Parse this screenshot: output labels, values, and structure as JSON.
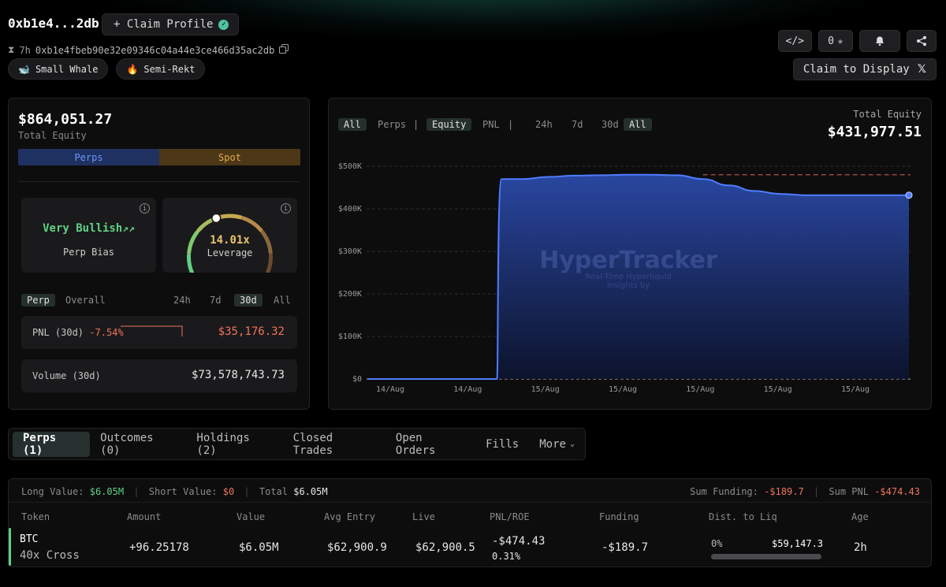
{
  "header": {
    "address_short": "0xb1e4...2db",
    "claim_profile_label": "+ Claim Profile",
    "age": "7h",
    "address_full": "0xb1e4fbeb90e32e09346c04a44e3ce466d35ac2db",
    "tags": [
      {
        "label": "Small Whale",
        "icon": "whale-icon"
      },
      {
        "label": "Semi-Rekt",
        "icon": "fire-icon"
      }
    ],
    "star_count": "0",
    "claim_display_label": "Claim to Display"
  },
  "summary": {
    "total_equity": "$864,051.27",
    "total_equity_label": "Total Equity",
    "perps_label": "Perps",
    "spot_label": "Spot",
    "perps_fraction": 0.5,
    "bias_value": "Very Bullish",
    "bias_label": "Perp Bias",
    "leverage_value": "14.01x",
    "leverage_label": "Leverage",
    "leverage_needle_fraction": 0.42,
    "scope_tabs": [
      "Perp",
      "Overall"
    ],
    "timeframes": [
      "24h",
      "7d",
      "30d",
      "All"
    ],
    "pnl_label": "PNL (30d)",
    "pnl_pct": "-7.54%",
    "pnl_value": "$35,176.32",
    "volume_label": "Volume (30d)",
    "volume_value": "$73,578,743.73"
  },
  "chart_panel": {
    "chips": [
      "All",
      "Perps",
      "|",
      "Equity",
      "PNL",
      "|",
      "24h",
      "7d",
      "30d",
      "All"
    ],
    "total_equity_label": "Total Equity",
    "total_equity_value": "$431,977.51",
    "watermark_title": "HyperTracker",
    "watermark_line1": "Real-Time Hyperliquid",
    "watermark_line2": "Insights by"
  },
  "chart_data": {
    "type": "area",
    "title": "",
    "xlabel": "",
    "ylabel": "",
    "ylim": [
      0,
      500000
    ],
    "y_ticks": [
      "$0",
      "$100K",
      "$200K",
      "$300K",
      "$400K",
      "$500K"
    ],
    "x_ticks": [
      "14/Aug",
      "14/Aug",
      "15/Aug",
      "15/Aug",
      "15/Aug",
      "15/Aug",
      "15/Aug"
    ],
    "series": [
      {
        "values": [
          0,
          0,
          0,
          0,
          0,
          0,
          470000,
          475000,
          478000,
          479000,
          480000,
          480000,
          479000,
          470000,
          455000,
          442000,
          435000,
          432000,
          432000,
          432000,
          432000,
          431977
        ]
      }
    ],
    "reference_line": 480000,
    "grid": true
  },
  "tabs": [
    {
      "label": "Perps (1)",
      "active": true
    },
    {
      "label": "Outcomes (0)",
      "active": false
    },
    {
      "label": "Holdings (2)",
      "active": false
    },
    {
      "label": "Closed Trades",
      "active": false
    },
    {
      "label": "Open Orders",
      "active": false
    },
    {
      "label": "Fills",
      "active": false
    },
    {
      "label": "More",
      "active": false
    }
  ],
  "positions": {
    "long_label": "Long Value:",
    "long_value": "$6.05M",
    "short_label": "Short Value:",
    "short_value": "$0",
    "total_label": "Total",
    "total_value": "$6.05M",
    "sum_funding_label": "Sum Funding:",
    "sum_funding_value": "-$189.7",
    "sum_pnl_label": "Sum PNL",
    "sum_pnl_value": "-$474.43",
    "columns": [
      "Token",
      "Amount",
      "Value",
      "Avg Entry",
      "Live",
      "PNL/ROE",
      "Funding",
      "Dist. to Liq",
      "Age"
    ],
    "rows": [
      {
        "token": "BTC",
        "mode": "40x Cross",
        "amount": "+96.25178",
        "value": "$6.05M",
        "avg_entry": "$62,900.9",
        "live": "$62,900.5",
        "pnl": "-$474.43",
        "roe": "0.31%",
        "funding": "-$189.7",
        "dist_pct": "0%",
        "liq_price": "$59,147.3",
        "age": "2h"
      }
    ]
  },
  "colors": {
    "positive": "#5fd084",
    "negative": "#f0735a",
    "chart_line": "#4f7dff",
    "accent_gold": "#e8c46a"
  }
}
